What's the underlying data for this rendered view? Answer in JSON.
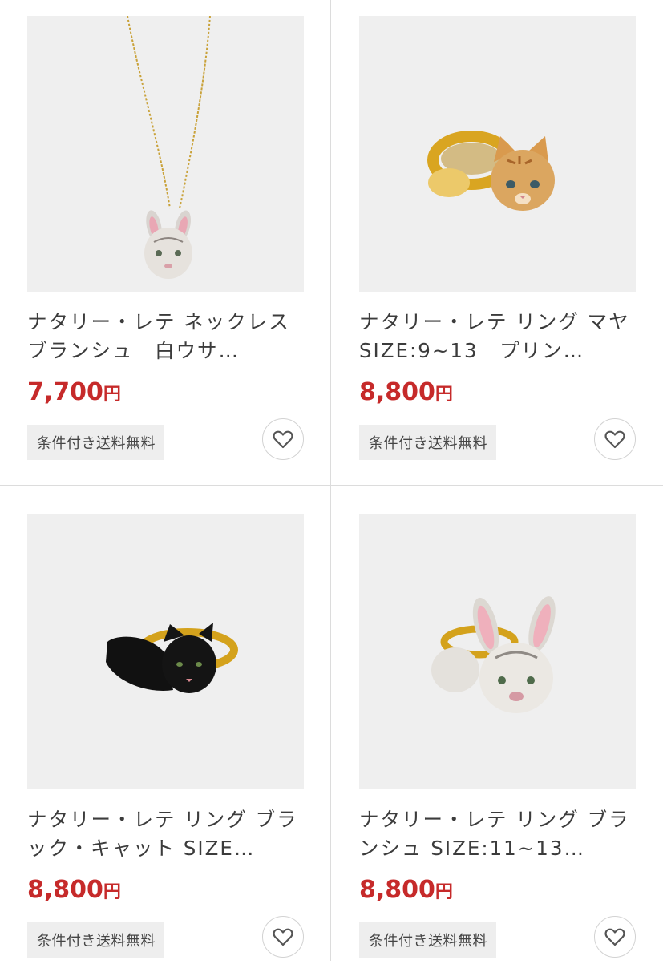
{
  "products": [
    {
      "title": "ナタリー・レテ ネックレス ブランシュ　白ウサ…",
      "price": "7,700",
      "currency": "円",
      "shipping": "条件付き送料無料",
      "image_subject": "white-rabbit-necklace"
    },
    {
      "title": "ナタリー・レテ リング マヤ SIZE:9~13　プリン…",
      "price": "8,800",
      "currency": "円",
      "shipping": "条件付き送料無料",
      "image_subject": "orange-tabby-cat-ring"
    },
    {
      "title": "ナタリー・レテ リング ブラック・キャット SIZE…",
      "price": "8,800",
      "currency": "円",
      "shipping": "条件付き送料無料",
      "image_subject": "black-cat-ring"
    },
    {
      "title": "ナタリー・レテ リング ブランシュ SIZE:11~13…",
      "price": "8,800",
      "currency": "円",
      "shipping": "条件付き送料無料",
      "image_subject": "white-rabbit-ring"
    }
  ],
  "colors": {
    "price": "#c62a2a",
    "shipping_bg": "#eeeeee",
    "divider": "#dcdcdc"
  },
  "icons": {
    "favorite": "heart-outline-icon"
  }
}
